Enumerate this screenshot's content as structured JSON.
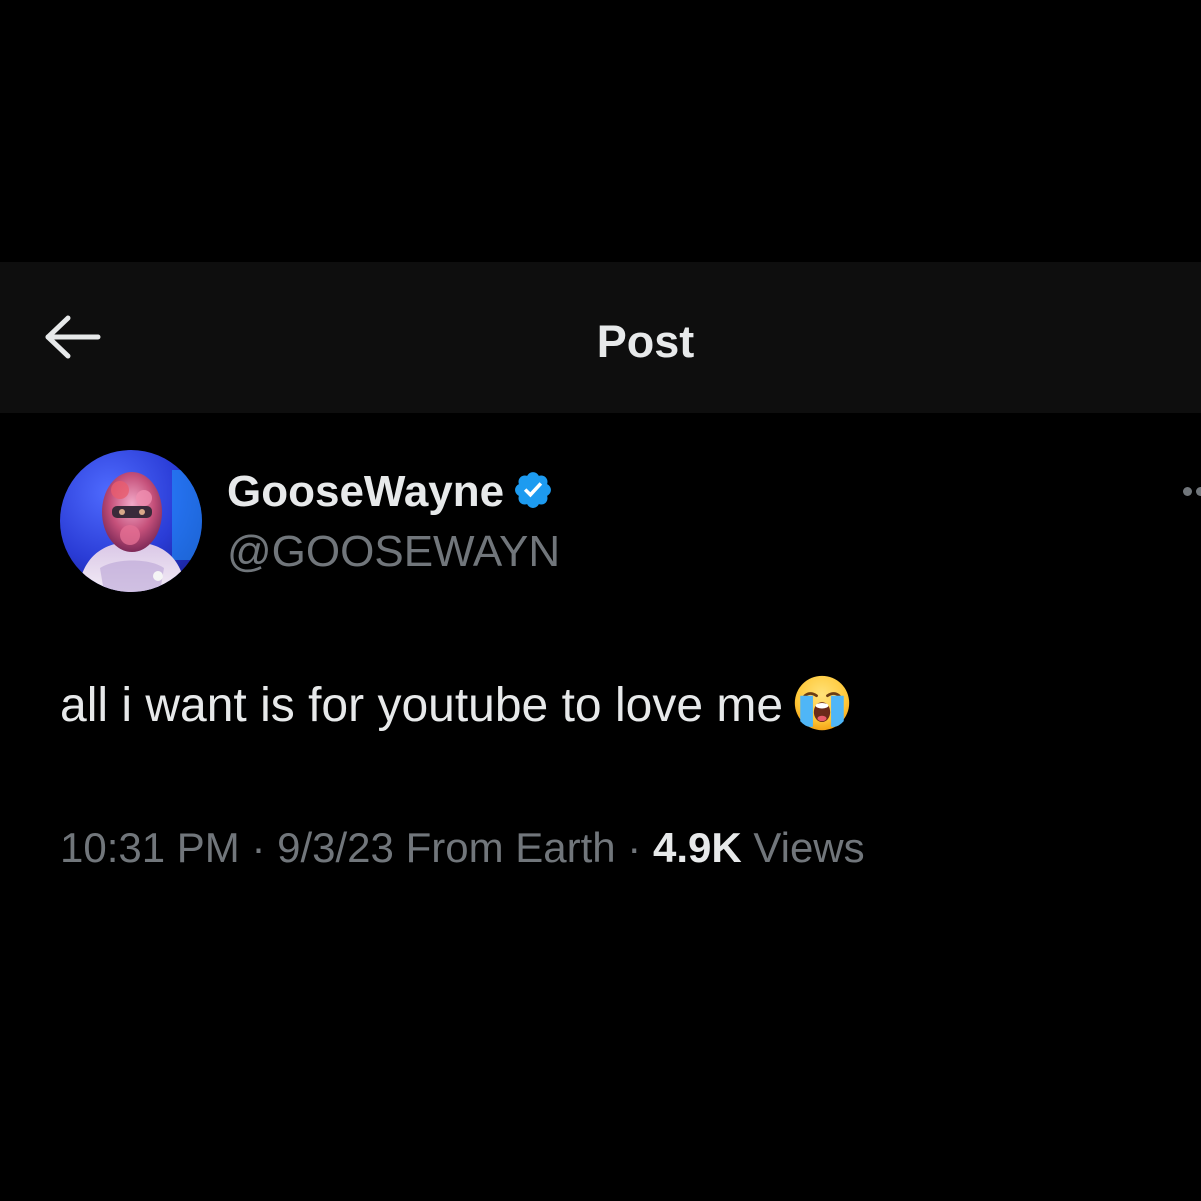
{
  "header": {
    "title": "Post",
    "back_icon": "arrow-left-icon"
  },
  "post": {
    "author": {
      "display_name": "GooseWayne",
      "handle": "@GOOSEWAYN",
      "verified": true,
      "verified_icon": "verified-badge-icon",
      "avatar": "avatar-photo"
    },
    "text": "all i want is for youtube to love me",
    "emoji": "loudly-crying-face-emoji",
    "time": "10:31 PM",
    "separator": "·",
    "date": "9/3/23",
    "source": "From Earth",
    "views_count": "4.9K",
    "views_label": "Views",
    "more_icon": "more-options-icon"
  },
  "colors": {
    "background": "#000000",
    "header_background": "#0e0e0e",
    "primary_text": "#e7e9ea",
    "secondary_text": "#71767b",
    "verified_blue": "#1d9bf0"
  }
}
